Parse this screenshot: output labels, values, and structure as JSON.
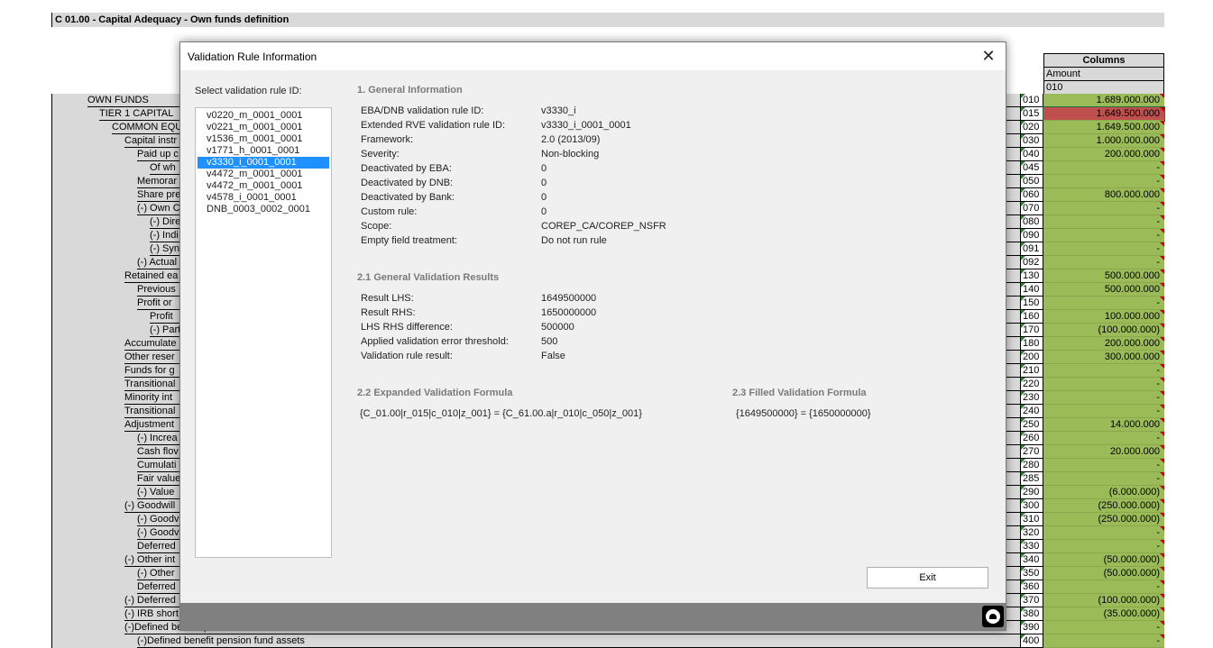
{
  "sheet": {
    "title": "C 01.00 - Capital Adequacy - Own funds definition",
    "columns_header": "Columns",
    "amount_header": "Amount",
    "column_code": "010"
  },
  "rows": [
    {
      "label": "OWN FUNDS",
      "code": "010",
      "value": "1.689.000.000"
    },
    {
      "label": "TIER 1 CAPITAL",
      "code": "015",
      "value": "1.649.500.000",
      "error": true
    },
    {
      "label": "COMMON EQU",
      "code": "020",
      "value": "1.649.500.000"
    },
    {
      "label": "Capital instr",
      "code": "030",
      "value": "1.000.000.000"
    },
    {
      "label": "Paid up c",
      "code": "040",
      "value": "200.000.000"
    },
    {
      "label": "Of wh",
      "code": "045",
      "value": "-"
    },
    {
      "label": "Memorar",
      "code": "050",
      "value": "-"
    },
    {
      "label": "Share pre",
      "code": "060",
      "value": "800.000.000"
    },
    {
      "label": "(-) Own C",
      "code": "070",
      "value": "-"
    },
    {
      "label": "(-) Dire",
      "code": "080",
      "value": "-"
    },
    {
      "label": "(-) Indi",
      "code": "090",
      "value": "-"
    },
    {
      "label": "(-) Syn",
      "code": "091",
      "value": "-"
    },
    {
      "label": "(-) Actual",
      "code": "092",
      "value": "-"
    },
    {
      "label": "Retained ea",
      "code": "130",
      "value": "500.000.000"
    },
    {
      "label": "Previous",
      "code": "140",
      "value": "500.000.000"
    },
    {
      "label": "Profit or",
      "code": "150",
      "value": "-"
    },
    {
      "label": "Profit",
      "code": "160",
      "value": "100.000.000"
    },
    {
      "label": "(-) Part",
      "code": "170",
      "value": "(100.000.000)"
    },
    {
      "label": "Accumulate",
      "code": "180",
      "value": "200.000.000"
    },
    {
      "label": "Other reser",
      "code": "200",
      "value": "300.000.000"
    },
    {
      "label": "Funds for g",
      "code": "210",
      "value": "-"
    },
    {
      "label": "Transitional",
      "code": "220",
      "value": "-"
    },
    {
      "label": "Minority int",
      "code": "230",
      "value": "-"
    },
    {
      "label": "Transitional",
      "code": "240",
      "value": "-"
    },
    {
      "label": "Adjustment",
      "code": "250",
      "value": "14.000.000"
    },
    {
      "label": "(-) Increa",
      "code": "260",
      "value": "-"
    },
    {
      "label": "Cash flov",
      "code": "270",
      "value": "20.000.000"
    },
    {
      "label": "Cumulati",
      "code": "280",
      "value": "-"
    },
    {
      "label": "Fair value",
      "code": "285",
      "value": "-"
    },
    {
      "label": "(-) Value",
      "code": "290",
      "value": "(6.000.000)"
    },
    {
      "label": "(-) Goodwill",
      "code": "300",
      "value": "(250.000.000)"
    },
    {
      "label": "(-) Goodv",
      "code": "310",
      "value": "(250.000.000)"
    },
    {
      "label": "(-) Goodv",
      "code": "320",
      "value": "-"
    },
    {
      "label": "Deferred",
      "code": "330",
      "value": "-"
    },
    {
      "label": "(-) Other int",
      "code": "340",
      "value": "(50.000.000)"
    },
    {
      "label": "(-) Other",
      "code": "350",
      "value": "(50.000.000)"
    },
    {
      "label": "Deferred",
      "code": "360",
      "value": "-"
    },
    {
      "label": "(-) Deferred",
      "code": "370",
      "value": "(100.000.000)"
    },
    {
      "label": "(-) IRB short",
      "code": "380",
      "value": "(35.000.000)"
    },
    {
      "label": "(-)Defined benefit pension fund assets",
      "code": "390",
      "value": "-"
    },
    {
      "label": "(-)Defined benefit pension fund assets",
      "code": "400",
      "value": "-"
    }
  ],
  "dialog": {
    "title": "Validation Rule Information",
    "close_glyph": "✕",
    "select_label": "Select validation rule ID:",
    "rules": [
      "v0220_m_0001_0001",
      "v0221_m_0001_0001",
      "v1536_m_0001_0001",
      "v1771_h_0001_0001",
      "v3330_i_0001_0001",
      "v4472_m_0001_0001",
      "v4472_m_0001_0001",
      "v4578_i_0001_0001",
      "DNB_0003_0002_0001"
    ],
    "selected_rule_index": 4,
    "general": {
      "heading": "1. General Information",
      "items": [
        {
          "label": "EBA/DNB validation rule ID:",
          "value": "v3330_i"
        },
        {
          "label": "Extended RVE validation rule ID:",
          "value": "v3330_i_0001_0001"
        },
        {
          "label": "Framework:",
          "value": "2.0 (2013/09)"
        },
        {
          "label": "Severity:",
          "value": "Non-blocking"
        },
        {
          "label": "Deactivated by EBA:",
          "value": "0"
        },
        {
          "label": "Deactivated by DNB:",
          "value": "0"
        },
        {
          "label": "Deactivated by Bank:",
          "value": "0"
        },
        {
          "label": "Custom rule:",
          "value": "0"
        },
        {
          "label": "Scope:",
          "value": "COREP_CA/COREP_NSFR"
        },
        {
          "label": "Empty field treatment:",
          "value": "Do not run rule"
        }
      ]
    },
    "results": {
      "heading": "2.1 General Validation Results",
      "items": [
        {
          "label": "Result LHS:",
          "value": "1649500000"
        },
        {
          "label": "Result RHS:",
          "value": "1650000000"
        },
        {
          "label": "LHS RHS difference:",
          "value": "500000"
        },
        {
          "label": "Applied validation error threshold:",
          "value": "500"
        },
        {
          "label": "Validation rule result:",
          "value": "False"
        }
      ]
    },
    "expanded": {
      "heading": "2.2 Expanded Validation Formula",
      "formula": "{C_01.00|r_015|c_010|z_001} = {C_61.00.a|r_010|c_050|z_001}"
    },
    "filled": {
      "heading": "2.3 Filled Validation Formula",
      "formula": "{1649500000} = {1650000000}"
    },
    "exit_label": "Exit",
    "footer_icon": "app-logo-icon"
  }
}
